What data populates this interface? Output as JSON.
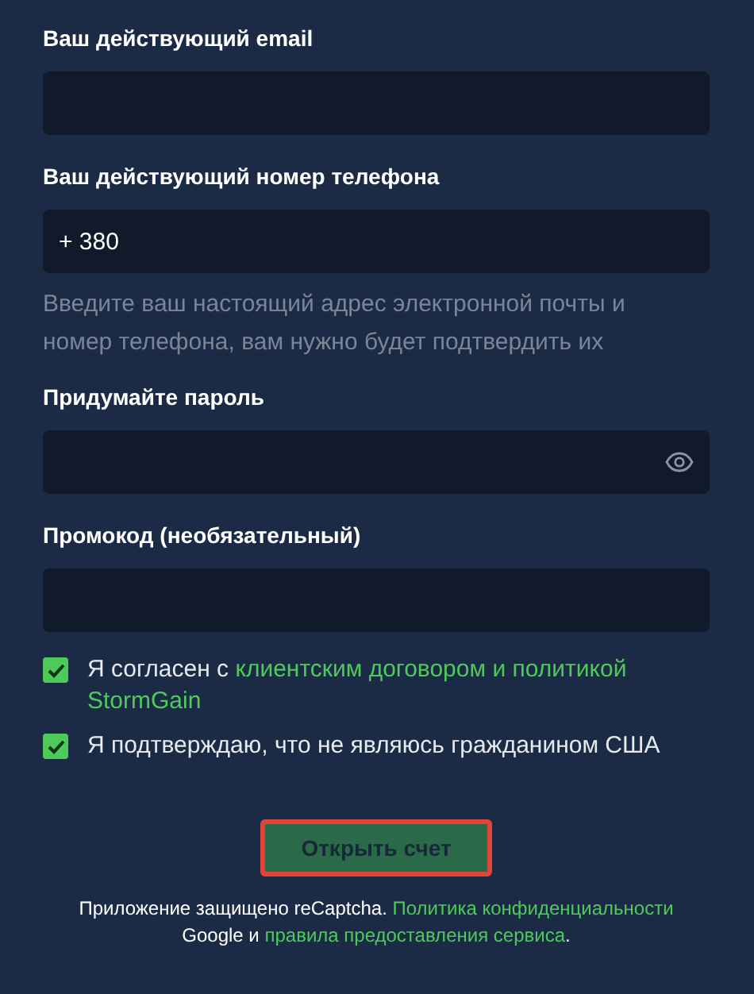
{
  "fields": [
    {
      "label": "Ваш действующий email",
      "kind": "text"
    },
    {
      "label": "Ваш действующий номер телефона",
      "kind": "text",
      "value": "+ 380",
      "hint": "Введите ваш настоящий адрес электронной почты и номер телефона, вам нужно будет подтвердить их"
    },
    {
      "label": "Придумайте пароль",
      "kind": "password"
    },
    {
      "label": "Промокод (необязательный)",
      "kind": "text"
    }
  ],
  "checkboxes": [
    {
      "checked": true,
      "parts": [
        {
          "text": "Я согласен с "
        },
        {
          "text": "клиентским договором и политикой",
          "link": true
        },
        {
          "text": "StormGain",
          "link": true,
          "new_line": true
        }
      ]
    },
    {
      "checked": true,
      "parts": [
        {
          "text": "Я подтверждаю, что не являюсь гражданином США"
        }
      ]
    }
  ],
  "submit": {
    "label": "Открыть счет",
    "disabled": true,
    "highlighted": true
  },
  "footer": {
    "parts": [
      {
        "text": "Приложение защищено reCaptcha. "
      },
      {
        "text": "Политика конфиденциальности",
        "link": true
      },
      {
        "text": " Google и "
      },
      {
        "text": "правила предоставления сервиса",
        "link": true
      },
      {
        "text": "."
      }
    ]
  }
}
